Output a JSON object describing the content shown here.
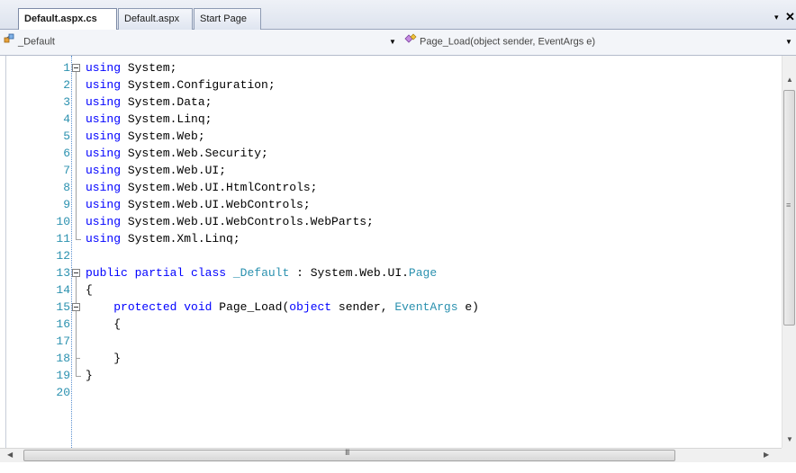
{
  "tabs": [
    {
      "label": "Default.aspx.cs",
      "active": true
    },
    {
      "label": "Default.aspx",
      "active": false
    },
    {
      "label": "Start Page",
      "active": false
    }
  ],
  "tab_controls": {
    "menu_icon": "▾",
    "close_icon": "✕"
  },
  "navbar": {
    "type_combo": {
      "icon": "class-icon",
      "value": "_Default"
    },
    "member_combo": {
      "icon": "method-icon",
      "value": "Page_Load(object sender, EventArgs e)"
    }
  },
  "editor": {
    "lines": [
      {
        "n": "1",
        "tokens": [
          [
            "kw",
            "using"
          ],
          [
            "",
            " System;"
          ]
        ]
      },
      {
        "n": "2",
        "tokens": [
          [
            "kw",
            "using"
          ],
          [
            "",
            " System.Configuration;"
          ]
        ]
      },
      {
        "n": "3",
        "tokens": [
          [
            "kw",
            "using"
          ],
          [
            "",
            " System.Data;"
          ]
        ]
      },
      {
        "n": "4",
        "tokens": [
          [
            "kw",
            "using"
          ],
          [
            "",
            " System.Linq;"
          ]
        ]
      },
      {
        "n": "5",
        "tokens": [
          [
            "kw",
            "using"
          ],
          [
            "",
            " System.Web;"
          ]
        ]
      },
      {
        "n": "6",
        "tokens": [
          [
            "kw",
            "using"
          ],
          [
            "",
            " System.Web.Security;"
          ]
        ]
      },
      {
        "n": "7",
        "tokens": [
          [
            "kw",
            "using"
          ],
          [
            "",
            " System.Web.UI;"
          ]
        ]
      },
      {
        "n": "8",
        "tokens": [
          [
            "kw",
            "using"
          ],
          [
            "",
            " System.Web.UI.HtmlControls;"
          ]
        ]
      },
      {
        "n": "9",
        "tokens": [
          [
            "kw",
            "using"
          ],
          [
            "",
            " System.Web.UI.WebControls;"
          ]
        ]
      },
      {
        "n": "10",
        "tokens": [
          [
            "kw",
            "using"
          ],
          [
            "",
            " System.Web.UI.WebControls.WebParts;"
          ]
        ]
      },
      {
        "n": "11",
        "tokens": [
          [
            "kw",
            "using"
          ],
          [
            "",
            " System.Xml.Linq;"
          ]
        ]
      },
      {
        "n": "12",
        "tokens": []
      },
      {
        "n": "13",
        "tokens": [
          [
            "kw",
            "public"
          ],
          [
            "",
            " "
          ],
          [
            "kw",
            "partial"
          ],
          [
            "",
            " "
          ],
          [
            "kw",
            "class"
          ],
          [
            "",
            " "
          ],
          [
            "ty",
            "_Default"
          ],
          [
            "",
            " : System.Web.UI."
          ],
          [
            "ty",
            "Page"
          ]
        ]
      },
      {
        "n": "14",
        "tokens": [
          [
            "",
            "{"
          ]
        ]
      },
      {
        "n": "15",
        "tokens": [
          [
            "",
            "    "
          ],
          [
            "kw",
            "protected"
          ],
          [
            "",
            " "
          ],
          [
            "kw",
            "void"
          ],
          [
            "",
            " Page_Load("
          ],
          [
            "kw",
            "object"
          ],
          [
            "",
            " sender, "
          ],
          [
            "ty",
            "EventArgs"
          ],
          [
            "",
            " e)"
          ]
        ]
      },
      {
        "n": "16",
        "tokens": [
          [
            "",
            "    {"
          ]
        ]
      },
      {
        "n": "17",
        "tokens": []
      },
      {
        "n": "18",
        "tokens": [
          [
            "",
            "    }"
          ]
        ]
      },
      {
        "n": "19",
        "tokens": [
          [
            "",
            "}"
          ]
        ]
      },
      {
        "n": "20",
        "tokens": []
      }
    ]
  },
  "scrollbars": {
    "grip": "≡",
    "h_grip": "III"
  },
  "colors": {
    "keyword": "#0000ff",
    "type": "#2b91af",
    "line_number": "#2b91af",
    "text": "#000000"
  }
}
